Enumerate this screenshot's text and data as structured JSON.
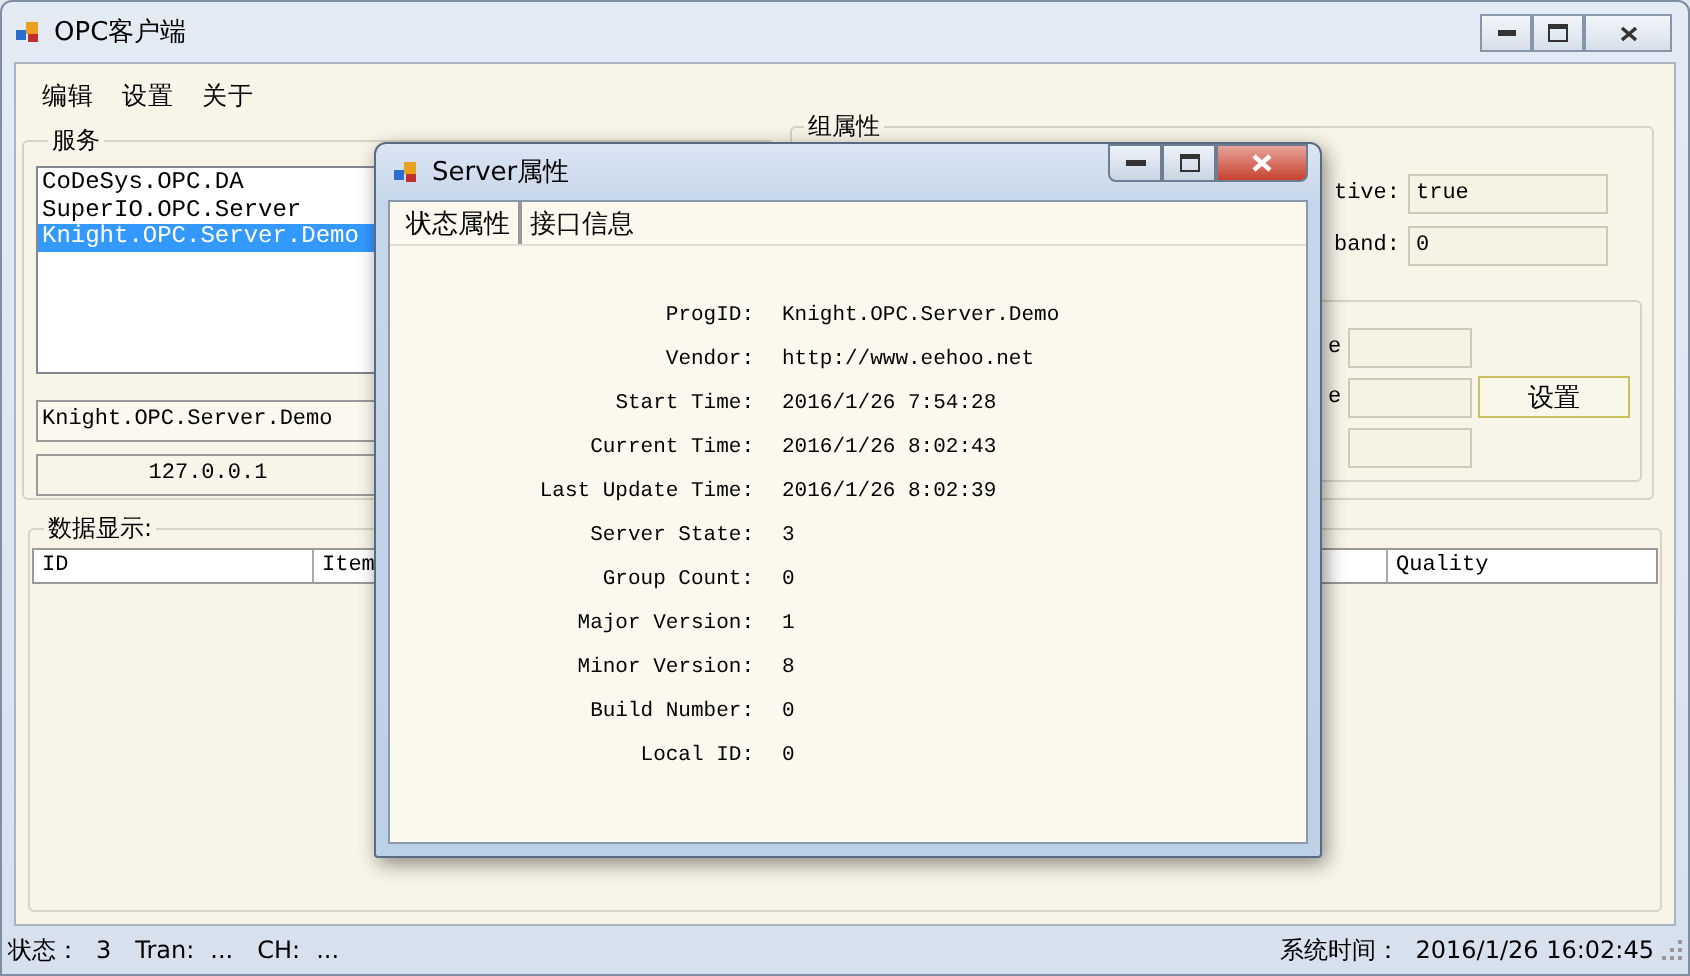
{
  "window": {
    "title": "OPC客户端"
  },
  "menu": [
    "编辑",
    "设置",
    "关于"
  ],
  "services": {
    "label": "服务",
    "items": [
      {
        "text": "CoDeSys.OPC.DA",
        "selected": false
      },
      {
        "text": "SuperIO.OPC.Server",
        "selected": false
      },
      {
        "text": "Knight.OPC.Server.Demo",
        "selected": true
      }
    ],
    "server_field": "Knight.OPC.Server.Demo",
    "host_field": "127.0.0.1"
  },
  "group": {
    "label": "组属性",
    "fields": [
      {
        "label": "tive:",
        "value": "true"
      },
      {
        "label": "band:",
        "value": "0"
      }
    ],
    "sub_labels": [
      "e",
      "e"
    ],
    "button": "设置"
  },
  "data": {
    "label": "数据显示:",
    "columns": [
      "ID",
      "Item",
      "Quality"
    ]
  },
  "status_bar": {
    "state_label": "状态：",
    "state": "3",
    "tran_label": "Tran:",
    "tran": "...",
    "ch_label": "CH:",
    "ch": "...",
    "time_label": "系统时间：",
    "time": "2016/1/26 16:02:45"
  },
  "dialog": {
    "title": "Server属性",
    "tabs": [
      {
        "label": "状态属性",
        "selected": true
      },
      {
        "label": "接口信息",
        "selected": false
      }
    ],
    "properties": [
      {
        "label": "ProgID:",
        "value": "Knight.OPC.Server.Demo"
      },
      {
        "label": "Vendor:",
        "value": "http://www.eehoo.net"
      },
      {
        "label": "Start Time:",
        "value": "2016/1/26 7:54:28"
      },
      {
        "label": "Current Time:",
        "value": "2016/1/26 8:02:43"
      },
      {
        "label": "Last Update Time:",
        "value": "2016/1/26 8:02:39"
      },
      {
        "label": "Server State:",
        "value": "3"
      },
      {
        "label": "Group Count:",
        "value": "0"
      },
      {
        "label": "Major Version:",
        "value": "1"
      },
      {
        "label": "Minor Version:",
        "value": "8"
      },
      {
        "label": "Build Number:",
        "value": "0"
      },
      {
        "label": "Local ID:",
        "value": "0"
      }
    ]
  }
}
